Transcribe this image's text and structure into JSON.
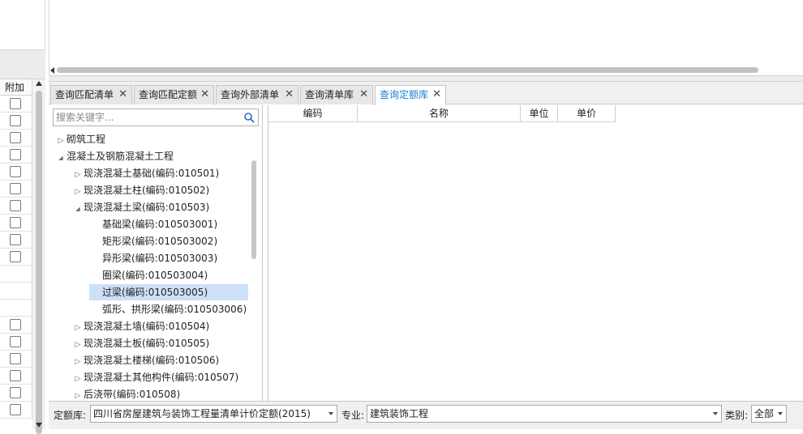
{
  "left_panel": {
    "addon_header": "附加",
    "rows": [
      {
        "checkbox": true
      },
      {
        "checkbox": true
      },
      {
        "checkbox": true
      },
      {
        "checkbox": true
      },
      {
        "checkbox": true
      },
      {
        "checkbox": true
      },
      {
        "checkbox": true
      },
      {
        "checkbox": true
      },
      {
        "checkbox": true
      },
      {
        "checkbox": true
      },
      {
        "checkbox": false
      },
      {
        "checkbox": false
      },
      {
        "checkbox": false
      },
      {
        "checkbox": true
      },
      {
        "checkbox": true
      },
      {
        "checkbox": true
      },
      {
        "checkbox": true
      },
      {
        "checkbox": true
      },
      {
        "checkbox": true
      }
    ]
  },
  "tabs": [
    {
      "label": "查询匹配清单",
      "active": false
    },
    {
      "label": "查询匹配定额",
      "active": false
    },
    {
      "label": "查询外部清单",
      "active": false
    },
    {
      "label": "查询清单库",
      "active": false
    },
    {
      "label": "查询定额库",
      "active": true
    }
  ],
  "tab_close_glyph": "✕",
  "search": {
    "placeholder": "搜索关键字..."
  },
  "tree": [
    {
      "label": "砌筑工程",
      "level": 0,
      "expander": "collapsed"
    },
    {
      "label": "混凝土及钢筋混凝土工程",
      "level": 0,
      "expander": "expanded"
    },
    {
      "label": "现浇混凝土基础(编码:010501)",
      "level": 1,
      "expander": "collapsed"
    },
    {
      "label": "现浇混凝土柱(编码:010502)",
      "level": 1,
      "expander": "collapsed"
    },
    {
      "label": "现浇混凝土梁(编码:010503)",
      "level": 1,
      "expander": "expanded"
    },
    {
      "label": "基础梁(编码:010503001)",
      "level": 2,
      "expander": "none"
    },
    {
      "label": "矩形梁(编码:010503002)",
      "level": 2,
      "expander": "none"
    },
    {
      "label": "异形梁(编码:010503003)",
      "level": 2,
      "expander": "none"
    },
    {
      "label": "圈梁(编码:010503004)",
      "level": 2,
      "expander": "none"
    },
    {
      "label": "过梁(编码:010503005)",
      "level": 2,
      "expander": "none",
      "selected": true
    },
    {
      "label": "弧形、拱形梁(编码:010503006)",
      "level": 2,
      "expander": "none"
    },
    {
      "label": "现浇混凝土墙(编码:010504)",
      "level": 1,
      "expander": "collapsed"
    },
    {
      "label": "现浇混凝土板(编码:010505)",
      "level": 1,
      "expander": "collapsed"
    },
    {
      "label": "现浇混凝土楼梯(编码:010506)",
      "level": 1,
      "expander": "collapsed"
    },
    {
      "label": "现浇混凝土其他构件(编码:010507)",
      "level": 1,
      "expander": "collapsed"
    },
    {
      "label": "后浇带(编码:010508)",
      "level": 1,
      "expander": "collapsed"
    }
  ],
  "grid": {
    "columns": [
      "编码",
      "名称",
      "单位",
      "单价"
    ]
  },
  "bottom": {
    "quota_label": "定额库:",
    "quota_value": "四川省房屋建筑与装饰工程量清单计价定额(2015)",
    "specialty_label": "专业:",
    "specialty_value": "建筑装饰工程",
    "category_label": "类别:",
    "category_value": "全部"
  },
  "colors": {
    "accent": "#1a7fd4",
    "selection": "#cde0f7"
  }
}
